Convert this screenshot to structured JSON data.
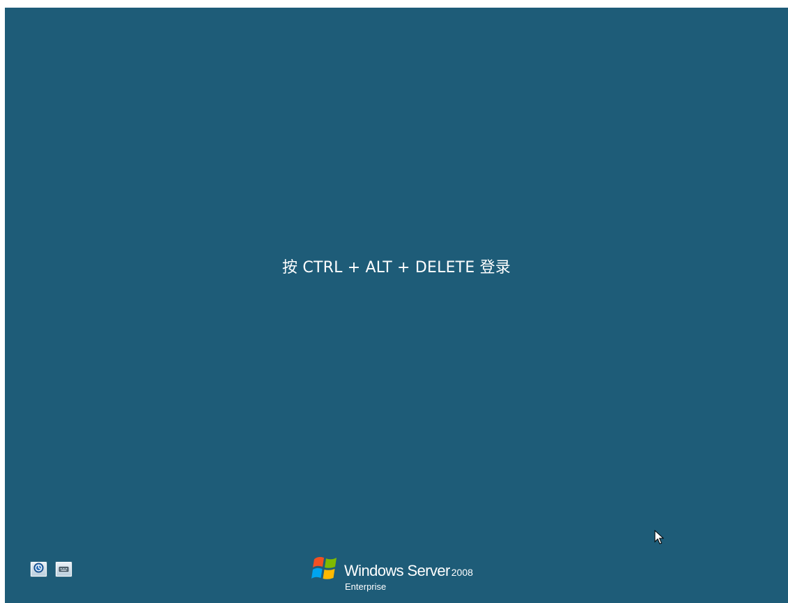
{
  "login_screen": {
    "prompt": "按 CTRL + ALT + DELETE 登录",
    "background_color": "#1e5c78"
  },
  "bottom_bar": {
    "buttons": [
      {
        "icon": "ease-of-access-icon"
      },
      {
        "icon": "keyboard-icon"
      }
    ]
  },
  "branding": {
    "product_name": "Windows Server",
    "version": "2008",
    "edition": "Enterprise",
    "logo": "windows-flag-icon"
  },
  "cursor": {
    "icon": "mouse-pointer-icon"
  }
}
